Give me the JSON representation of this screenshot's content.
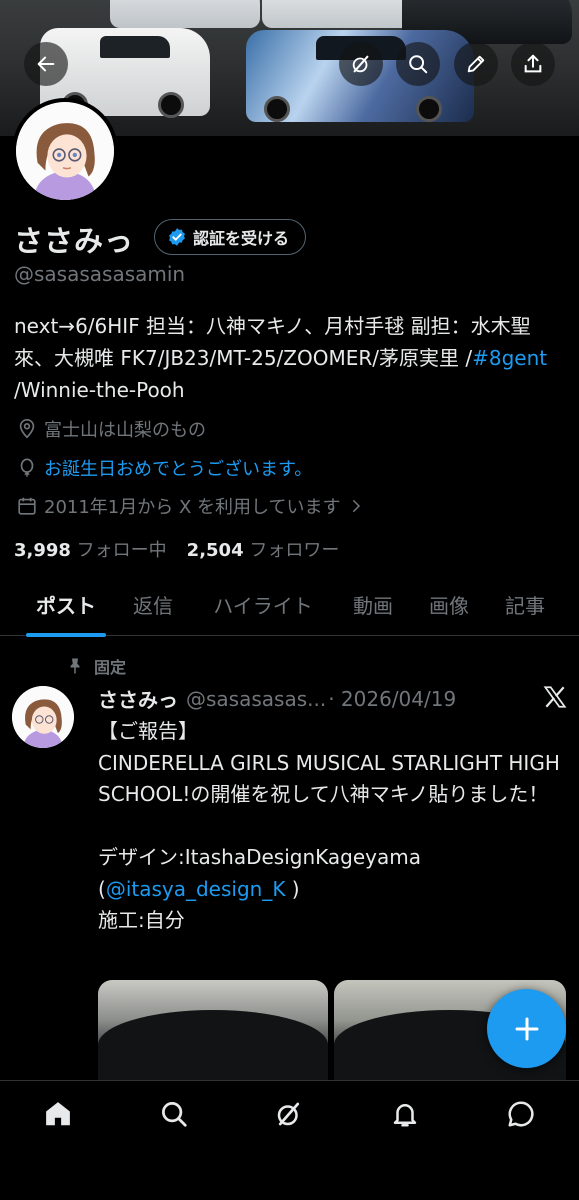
{
  "header": {
    "back_icon": "arrow-left-icon",
    "grok_icon": "grok-icon",
    "search_icon": "search-icon",
    "edit_icon": "pencil-icon",
    "share_icon": "share-icon"
  },
  "profile": {
    "display_name": "ささみっ",
    "verify_button": "認証を受ける",
    "handle": "@sasasasasamin",
    "bio_text": "next→6/6HIF 担当：八神マキノ、月村手毬 副担：水木聖來、大槻唯 FK7/JB23/MT-25/ZOOMER/茅原実里 /",
    "bio_hashtag": "#8gent",
    "bio_tail": " /Winnie-the-Pooh",
    "location": "富士山は山梨のもの",
    "birthday": "お誕生日おめでとうございます。",
    "joined": "2011年1月から X を利用しています",
    "following_count": "3,998",
    "following_label": "フォロー中",
    "followers_count": "2,504",
    "followers_label": "フォロワー"
  },
  "tabs": [
    {
      "label": "ポスト",
      "active": true
    },
    {
      "label": "返信",
      "active": false
    },
    {
      "label": "ハイライト",
      "active": false
    },
    {
      "label": "動画",
      "active": false
    },
    {
      "label": "画像",
      "active": false
    },
    {
      "label": "記事",
      "active": false
    }
  ],
  "post": {
    "pinned_label": "固定",
    "name": "ささみっ",
    "handle": "@sasasasas...",
    "date": "· 2026/04/19",
    "line1": "【ご報告】",
    "line2": "CINDERELLA GIRLS MUSICAL STARLIGHT HIGH SCHOOL!の開催を祝して八神マキノ貼りました！",
    "line3": "デザイン:ItashaDesignKageyama",
    "mention_open": "(",
    "mention": "@itasya_design_K",
    "mention_close": " )",
    "line4": "施工:自分"
  },
  "fab_icon": "plus-icon",
  "bottom_nav": [
    "home-icon",
    "search-icon",
    "grok-icon",
    "notifications-icon",
    "messages-icon"
  ],
  "colors": {
    "accent": "#1d9bf0",
    "text": "#e7e9ea",
    "muted": "#71767b",
    "border": "#2f3336",
    "background": "#000000"
  }
}
